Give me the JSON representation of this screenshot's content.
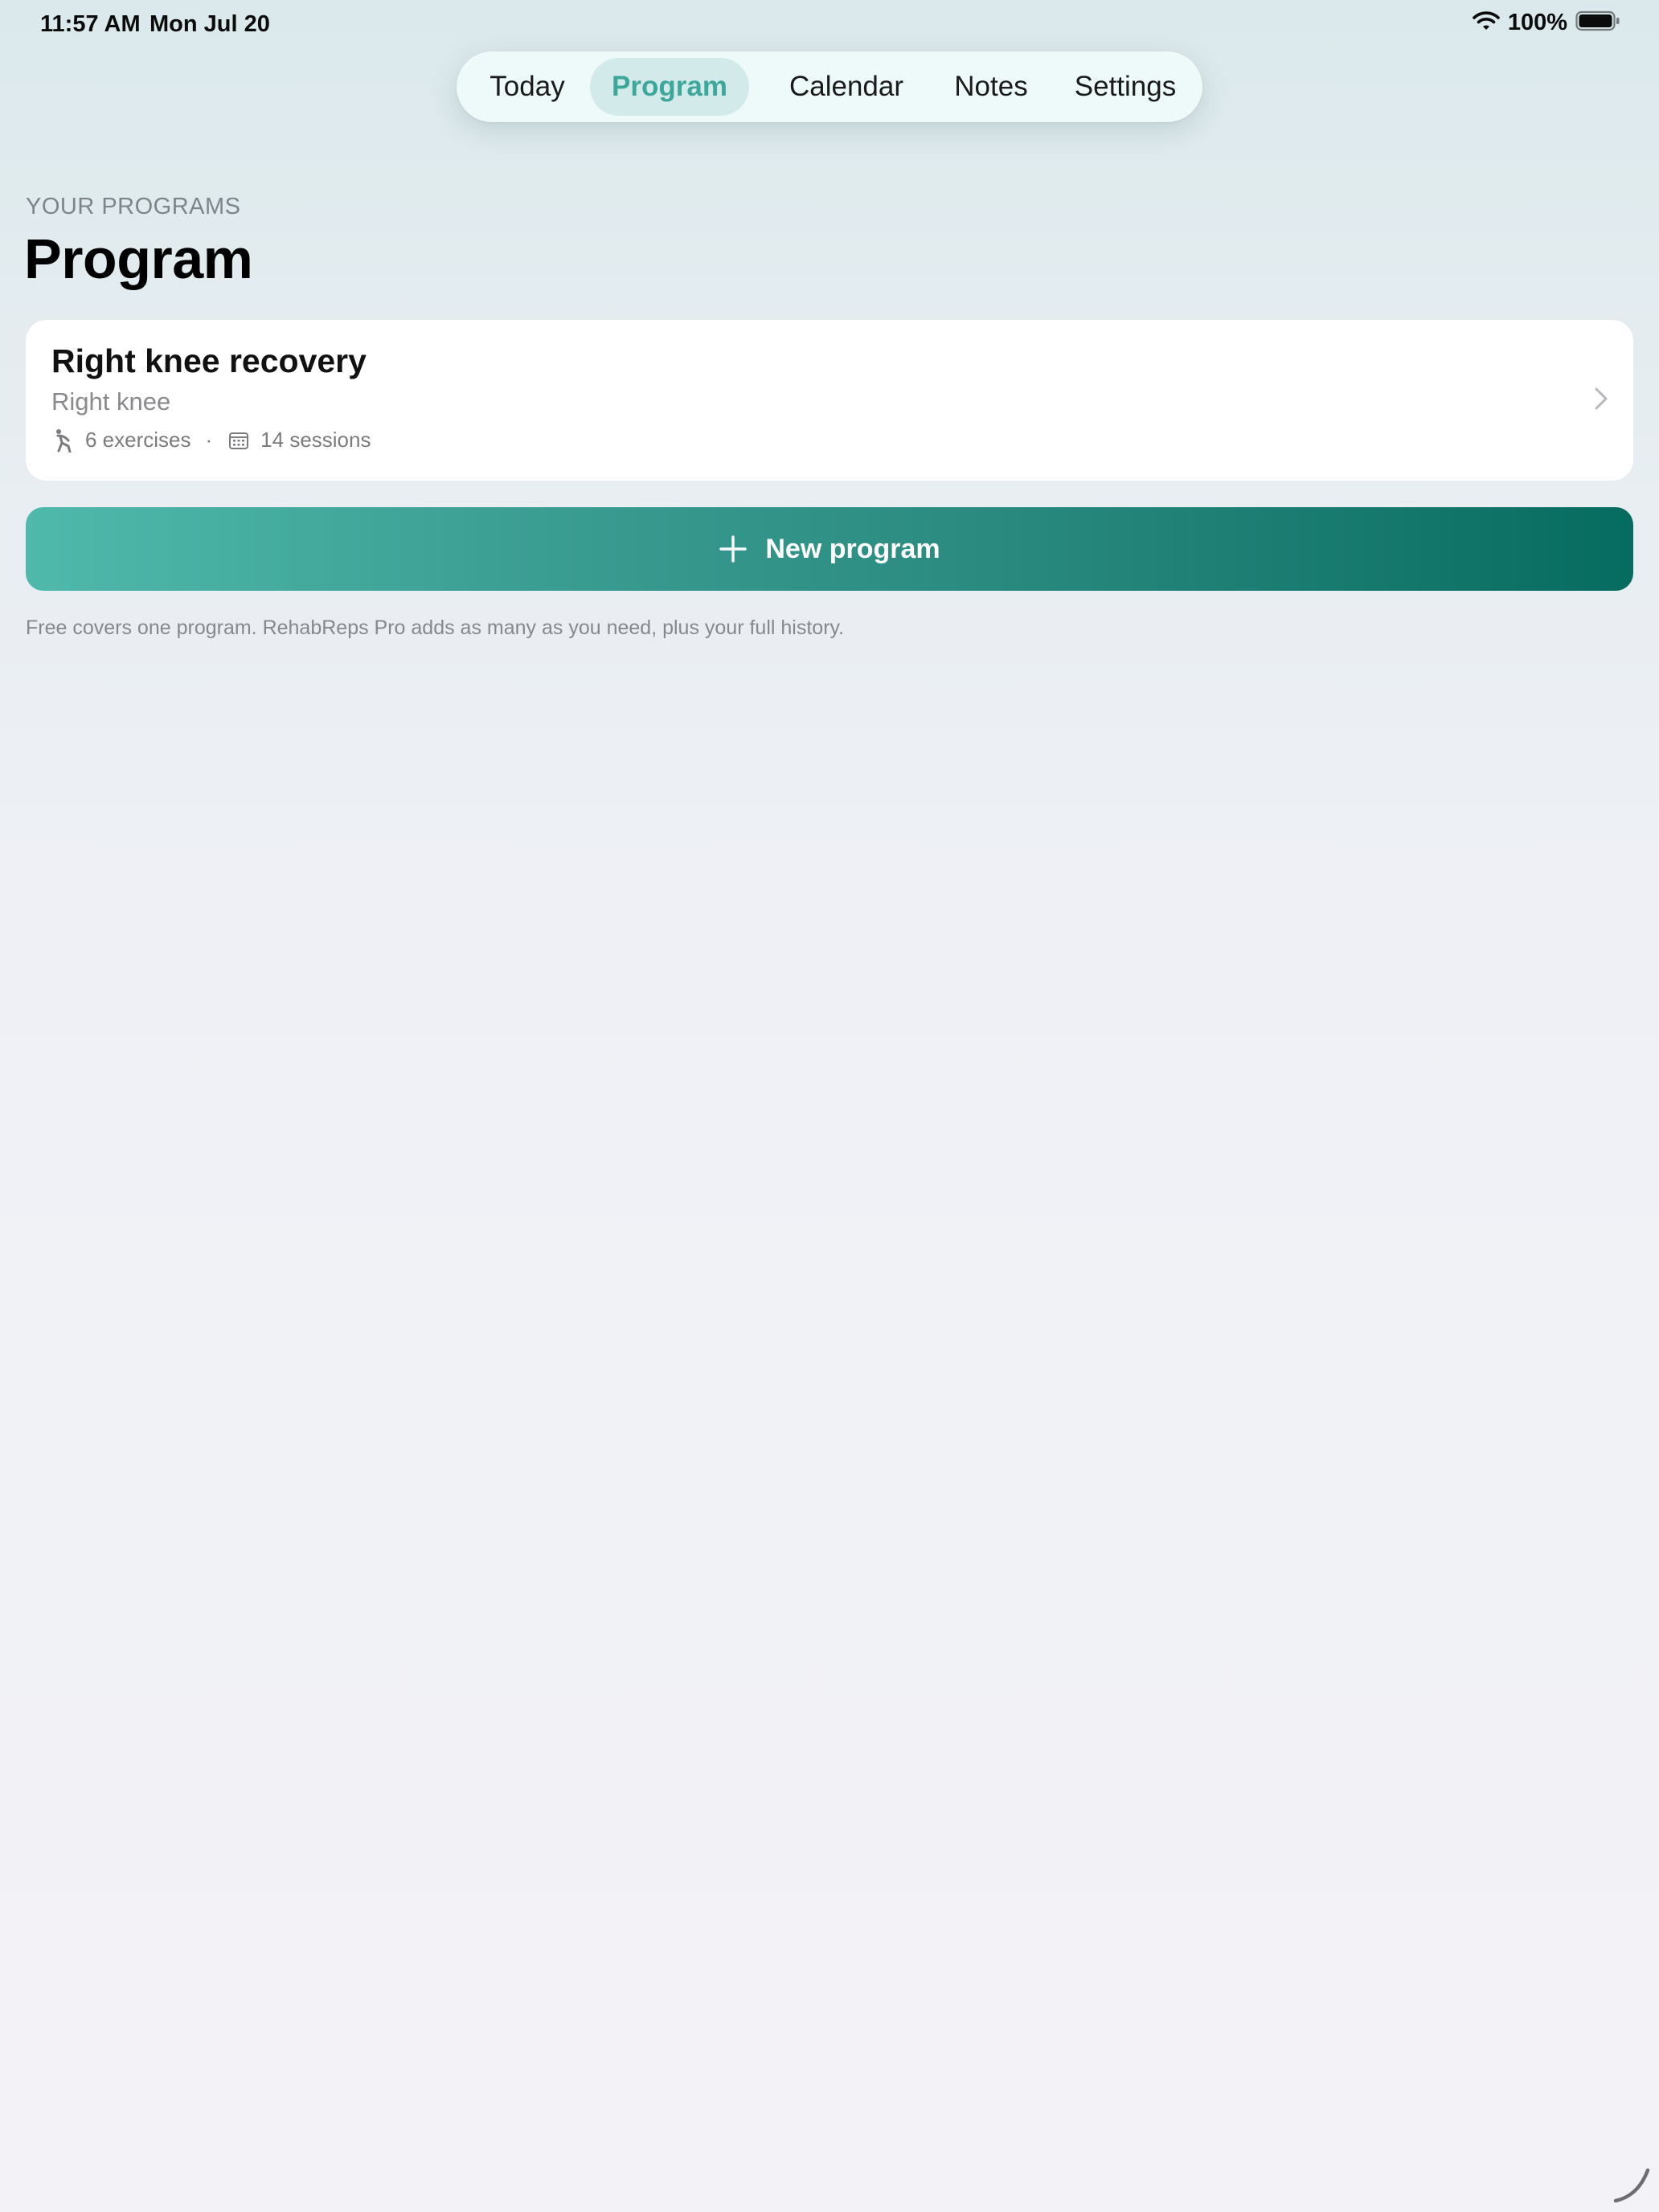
{
  "status_bar": {
    "time": "11:57 AM",
    "date": "Mon Jul 20",
    "battery": "100%",
    "icons": [
      "wifi-icon",
      "battery-icon"
    ]
  },
  "tabs": [
    {
      "label": "Today",
      "active": false
    },
    {
      "label": "Program",
      "active": true
    },
    {
      "label": "Calendar",
      "active": false
    },
    {
      "label": "Notes",
      "active": false
    },
    {
      "label": "Settings",
      "active": false
    }
  ],
  "header": {
    "eyebrow": "YOUR PROGRAMS",
    "title": "Program"
  },
  "programs": [
    {
      "title": "Right knee recovery",
      "subtitle": "Right knee",
      "exercises": "6 exercises",
      "separator": "·",
      "sessions": "14 sessions",
      "icons": [
        "stretch-figure-icon",
        "calendar-icon",
        "chevron-right-icon"
      ]
    }
  ],
  "new_program_button": {
    "label": "New program",
    "icon": "plus-icon",
    "gradient": [
      "#4fb9ac",
      "#066b60"
    ]
  },
  "footnote": "Free covers one program. RehabReps Pro adds as many as you need, plus your full history.",
  "colors": {
    "accent": "#3ea79c",
    "active_tab_bg": "#d2eaea",
    "tab_bar_bg": "#eef9fa",
    "card_bg": "#ffffff"
  }
}
